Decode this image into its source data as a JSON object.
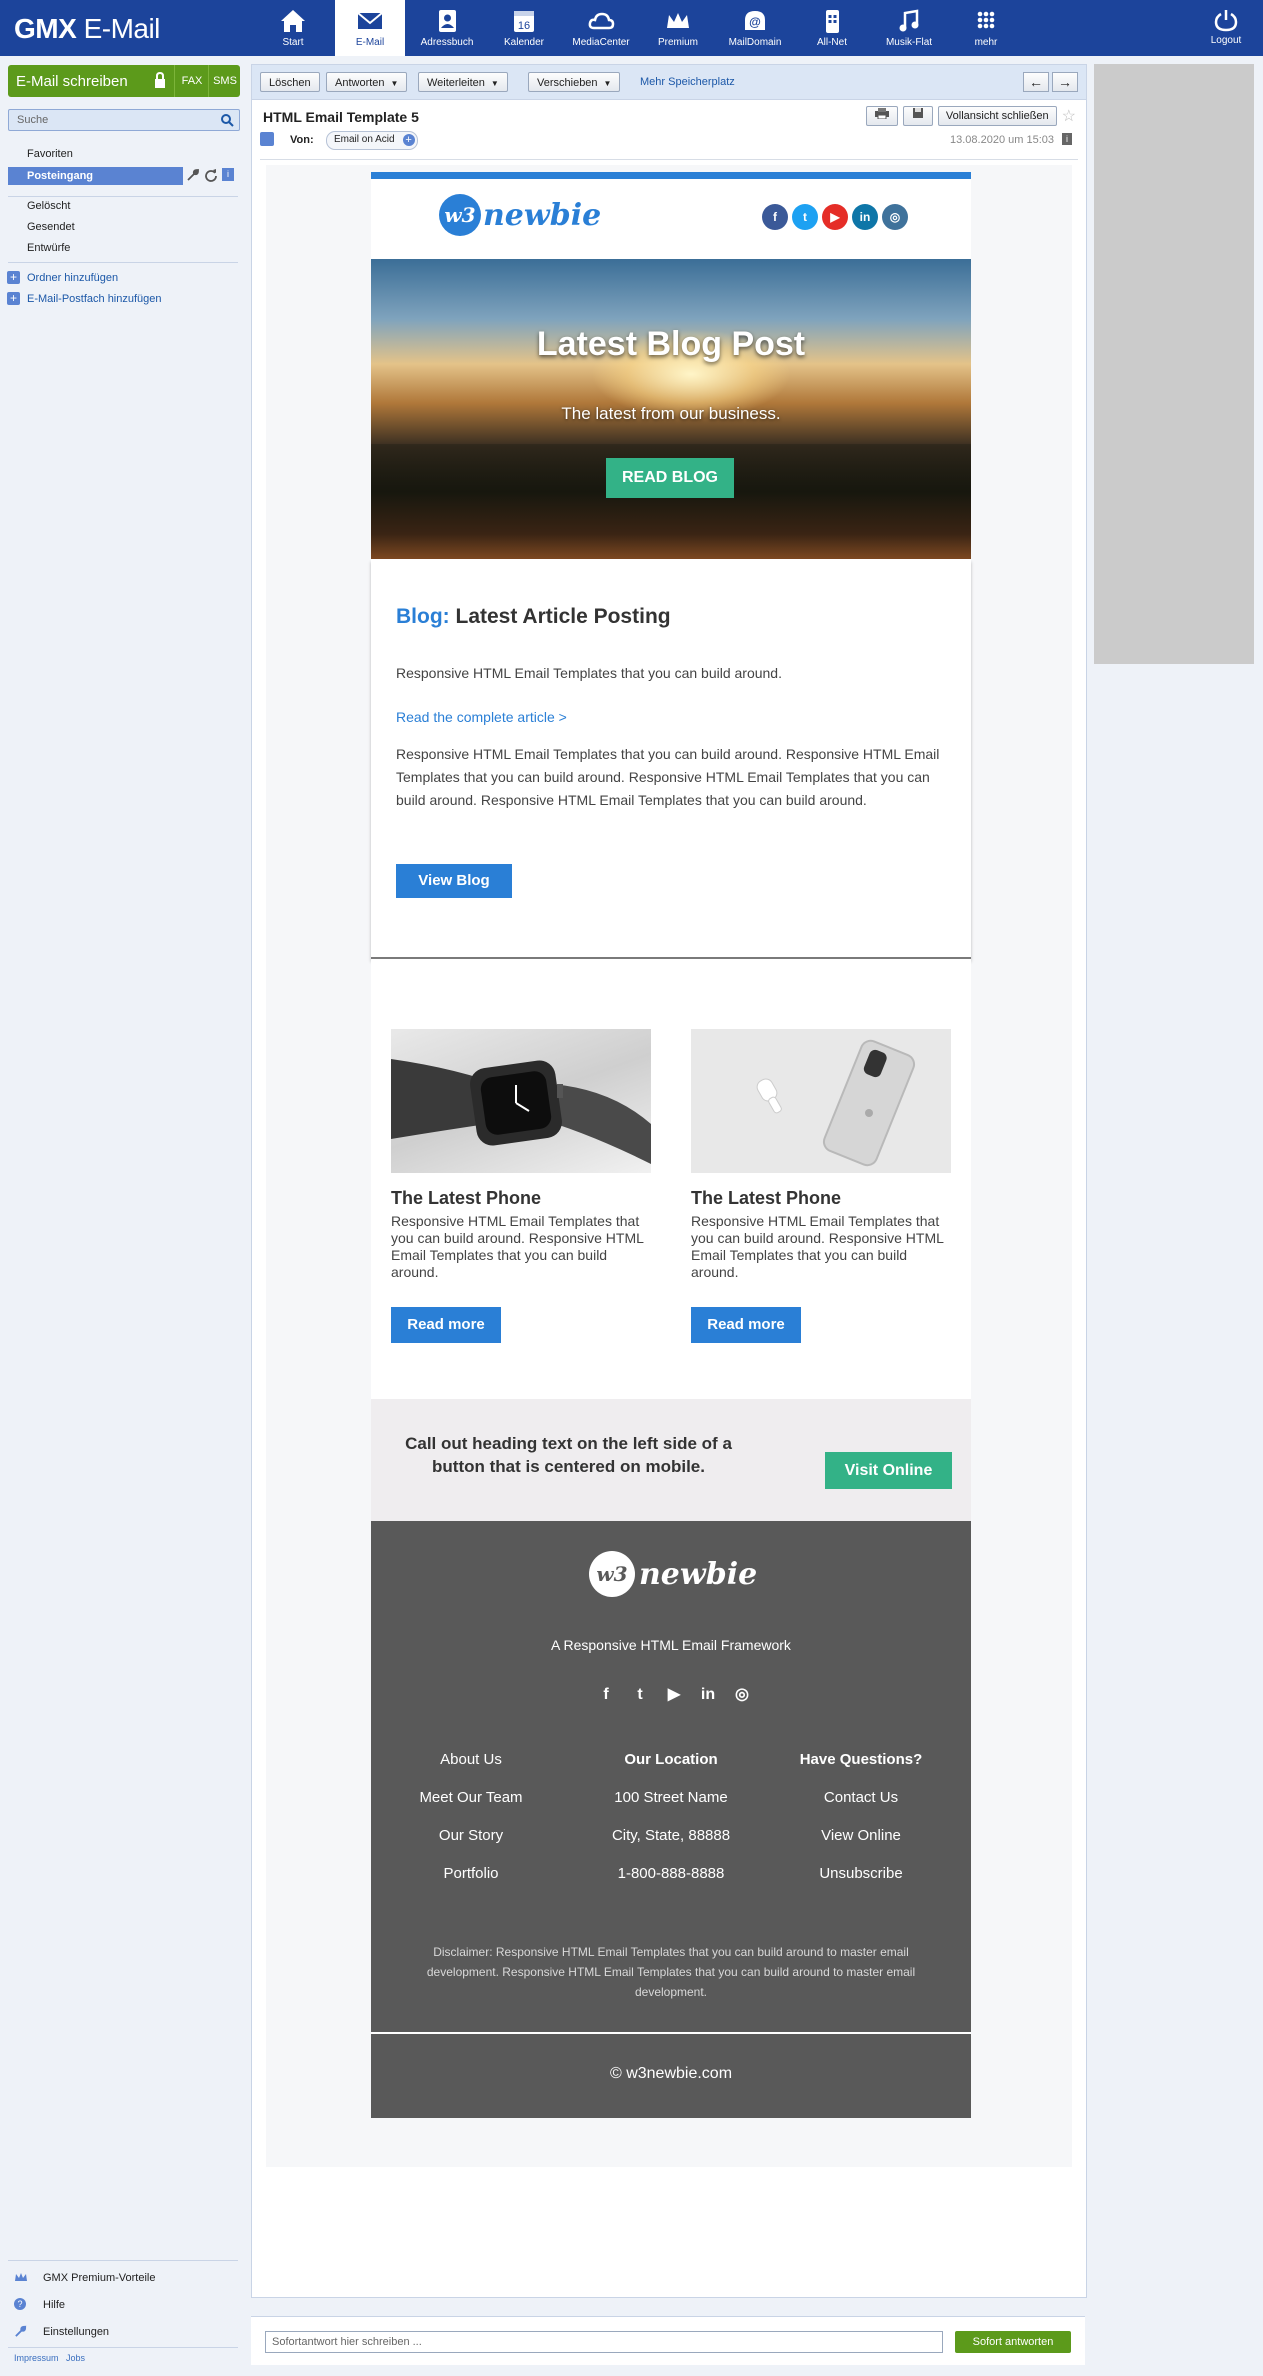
{
  "app": {
    "logo_bold": "GMX",
    "logo_rest": "E-Mail"
  },
  "nav": [
    {
      "label": "Start",
      "icon": "home-icon"
    },
    {
      "label": "E-Mail",
      "icon": "mail-icon",
      "active": true
    },
    {
      "label": "Adressbuch",
      "icon": "addressbook-icon"
    },
    {
      "label": "Kalender",
      "icon": "calendar-icon",
      "day": "16"
    },
    {
      "label": "MediaCenter",
      "icon": "cloud-icon"
    },
    {
      "label": "Premium",
      "icon": "crown-icon"
    },
    {
      "label": "MailDomain",
      "icon": "at-icon"
    },
    {
      "label": "All-Net",
      "icon": "phone-icon"
    },
    {
      "label": "Musik-Flat",
      "icon": "music-icon"
    },
    {
      "label": "mehr",
      "icon": "grid-icon"
    }
  ],
  "logout": {
    "label": "Logout"
  },
  "sidebar": {
    "compose": "E-Mail schreiben",
    "fax": "FAX",
    "sms": "SMS",
    "search_placeholder": "Suche",
    "folders": [
      "Favoriten",
      "Posteingang",
      "Gelöscht",
      "Gesendet",
      "Entwürfe"
    ],
    "add_folder": "Ordner hinzufügen",
    "add_mailbox": "E-Mail-Postfach hinzufügen",
    "bottom": [
      "GMX Premium-Vorteile",
      "Hilfe",
      "Einstellungen"
    ],
    "footer_links": [
      "Impressum",
      "Jobs"
    ]
  },
  "toolbar": {
    "delete": "Löschen",
    "reply": "Antworten",
    "forward": "Weiterleiten",
    "move": "Verschieben",
    "more_storage": "Mehr Speicherplatz"
  },
  "message": {
    "subject": "HTML Email Template 5",
    "close_full": "Vollansicht schließen",
    "from_label": "Von:",
    "from_name": "Email on Acid",
    "date": "13.08.2020 um 15:03"
  },
  "email": {
    "brand": "newbie",
    "brand_badge": "w3",
    "hero": {
      "title": "Latest Blog Post",
      "subtitle": "The latest from our business.",
      "button": "READ BLOG"
    },
    "blog": {
      "keyword": "Blog:",
      "heading": "Latest Article Posting",
      "intro": "Responsive HTML Email Templates that you can build around.",
      "link": "Read the complete article >",
      "body": "Responsive HTML Email Templates that you can build around. Responsive HTML Email Templates that you can build around. Responsive HTML Email Templates that you can build around. Responsive HTML Email Templates that you can build around.",
      "button": "View Blog"
    },
    "products": [
      {
        "title": "The Latest Phone",
        "desc": "Responsive HTML Email Templates that you can build around. Responsive HTML Email Templates that you can build around.",
        "button": "Read more"
      },
      {
        "title": "The Latest Phone",
        "desc": "Responsive HTML Email Templates that you can build around. Responsive HTML Email Templates that you can build around.",
        "button": "Read more"
      }
    ],
    "callout": {
      "text": "Call out heading text on the left side of a button that is centered on mobile.",
      "button": "Visit Online"
    },
    "footer": {
      "tagline": "A Responsive HTML Email Framework",
      "col1": [
        "About Us",
        "Meet Our Team",
        "Our Story",
        "Portfolio"
      ],
      "col2_head": "Our Location",
      "col2": [
        "100 Street Name",
        "City, State, 88888",
        "1-800-888-8888"
      ],
      "col3_head": "Have Questions?",
      "col3": [
        "Contact Us",
        "View Online",
        "Unsubscribe"
      ],
      "disclaimer": "Disclaimer: Responsive HTML Email Templates that you can build around to master email development. Responsive HTML Email Templates that you can build around to master email development.",
      "copyright": "© w3newbie.com"
    }
  },
  "reply": {
    "placeholder": "Sofortantwort hier schreiben ...",
    "button": "Sofort antworten"
  },
  "colors": {
    "brand_blue": "#1c449b",
    "compose_green": "#5c9a1b",
    "email_blue": "#2a7fd6",
    "email_green": "#33b287",
    "footer_gray": "#595959"
  }
}
